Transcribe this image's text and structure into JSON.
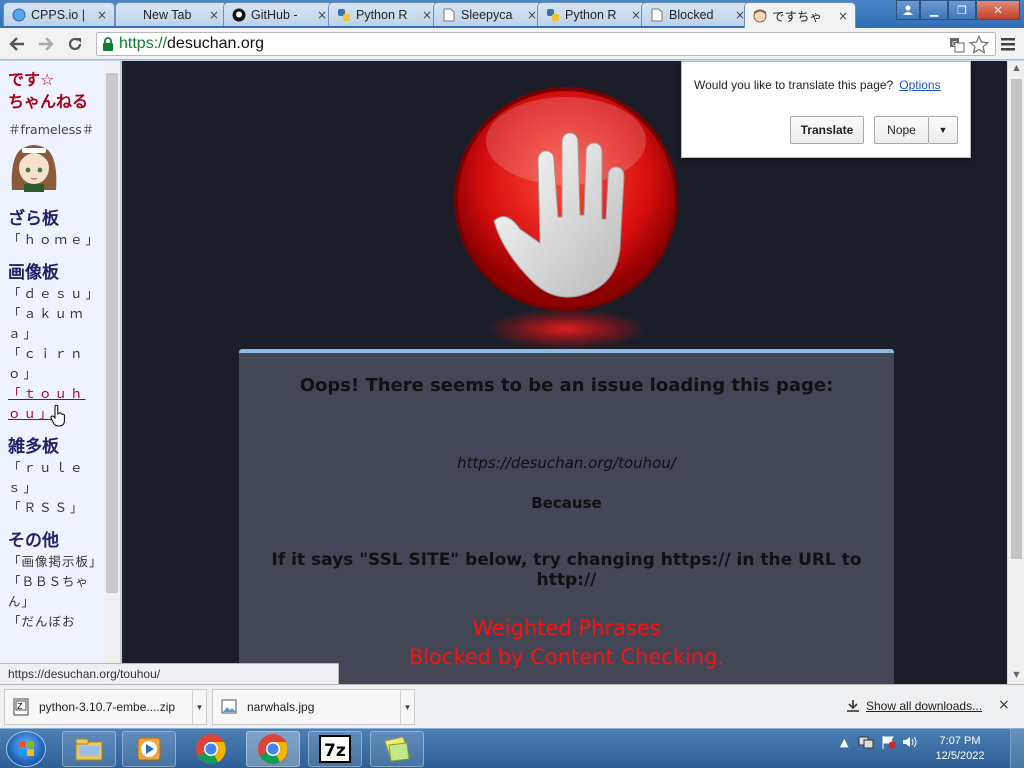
{
  "browser": {
    "tabs": [
      {
        "title": "CPPS.io |",
        "close": "×",
        "icon": "globe-icon"
      },
      {
        "title": "New Tab",
        "close": "×",
        "icon": "page-icon"
      },
      {
        "title": "GitHub -",
        "close": "×",
        "icon": "github-icon"
      },
      {
        "title": "Python R",
        "close": "×",
        "icon": "python-icon"
      },
      {
        "title": "Sleepyca",
        "close": "×",
        "icon": "page-icon"
      },
      {
        "title": "Python R",
        "close": "×",
        "icon": "python-icon"
      },
      {
        "title": "Blocked",
        "close": "×",
        "icon": "page-icon"
      },
      {
        "title": "ですちゃ",
        "close": "×",
        "icon": "anime-face-icon"
      }
    ],
    "address": {
      "scheme": "https://",
      "host": "desuchan.org"
    }
  },
  "sidebar": {
    "title_line1": "です☆",
    "title_line2": "ちゃんねる",
    "subtitle": "＃frameless＃",
    "sections": [
      {
        "heading": "ざら板",
        "links": [
          "「ｈｏｍｅ」"
        ]
      },
      {
        "heading": "画像板",
        "links": [
          "「ｄｅｓｕ」",
          "「ａｋｕｍａ」",
          "「ｃｉｒｎｏ」",
          "「ｔｏｕｈｏｕ」"
        ]
      },
      {
        "heading": "雑多板",
        "links": [
          "「ｒｕｌｅｓ」",
          "「ＲＳＳ」"
        ]
      },
      {
        "heading": "その他",
        "links": [
          "「画像掲示板」",
          "「ＢＢＳちゃん」",
          "「だんぼお"
        ]
      }
    ]
  },
  "block_page": {
    "title": "Oops! There seems to be an issue loading this page:",
    "url": "https://desuchan.org/touhou/",
    "because": "Because",
    "ssl_note": "If it says \"SSL SITE\" below, try changing https:// in the URL to http://",
    "reason_line1": "Weighted Phrases",
    "reason_line2": "Blocked by Content Checking."
  },
  "translate": {
    "question": "Would you like to translate this page?",
    "options": "Options",
    "translate_btn": "Translate",
    "nope_btn": "Nope"
  },
  "status_url": "https://desuchan.org/touhou/",
  "downloads": {
    "items": [
      {
        "name": "python-3.10.7-embe....zip",
        "icon": "zip-icon"
      },
      {
        "name": "narwhals.jpg",
        "icon": "image-file-icon"
      }
    ],
    "show_all": "Show all downloads...",
    "close": "×"
  },
  "taskbar": {
    "apps": [
      "explorer-icon",
      "media-player-icon",
      "chrome-icon",
      "chrome-icon",
      "7zip-icon",
      "sticky-notes-icon"
    ],
    "time": "7:07 PM",
    "date": "12/5/2022"
  },
  "colors": {
    "accent": "#a7001b",
    "blocked_text": "#ff1010",
    "address_secure": "#0b7e2f"
  }
}
